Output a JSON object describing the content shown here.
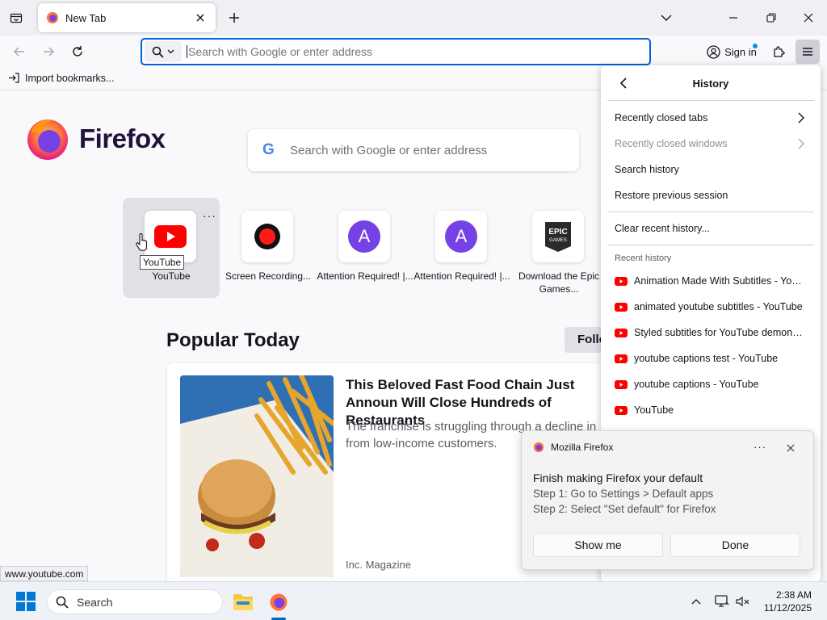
{
  "tab": {
    "title": "New Tab"
  },
  "urlbar": {
    "placeholder": "Search with Google or enter address"
  },
  "toolbar": {
    "signin_label": "Sign in"
  },
  "bookmarks": {
    "import_label": "Import bookmarks..."
  },
  "home": {
    "brand": "Firefox",
    "search_placeholder": "Search with Google or enter address",
    "shortcuts": [
      {
        "label": "YouTube",
        "tooltip": "YouTube"
      },
      {
        "label": "Screen Recording..."
      },
      {
        "label": "Attention Required! |..."
      },
      {
        "label": "Attention Required! |..."
      },
      {
        "label": "Download the Epic Games..."
      }
    ],
    "section_title": "Popular Today",
    "follow_label": "Follo",
    "story": {
      "headline": "This Beloved Fast Food Chain Just Announ Will Close Hundreds of Restaurants",
      "excerpt": "The franchise is struggling through a decline in from low-income customers.",
      "source": "Inc. Magazine"
    }
  },
  "history_panel": {
    "title": "History",
    "items": [
      {
        "label": "Recently closed tabs"
      },
      {
        "label": "Recently closed windows"
      },
      {
        "label": "Search history"
      },
      {
        "label": "Restore previous session"
      }
    ],
    "clear_label": "Clear recent history...",
    "recent_heading": "Recent history",
    "recent": [
      "Animation Made With Subtitles - YouT...",
      "animated youtube subtitles - YouTube",
      "Styled subtitles for YouTube demonstr...",
      "youtube captions test - YouTube",
      "youtube captions - YouTube",
      "YouTube"
    ]
  },
  "notification": {
    "app_name": "Mozilla Firefox",
    "title": "Finish making Firefox your default",
    "step1": "Step 1: Go to Settings > Default apps",
    "step2": "Step 2: Select \"Set default\" for Firefox",
    "show_me_label": "Show me",
    "done_label": "Done"
  },
  "status_url": "www.youtube.com",
  "taskbar": {
    "search_label": "Search",
    "time": "2:38 AM",
    "date": "11/12/2025"
  },
  "colors": {
    "accent": "#0061e0",
    "youtube_red": "#ff0000",
    "avatar_purple": "#7542e5"
  }
}
